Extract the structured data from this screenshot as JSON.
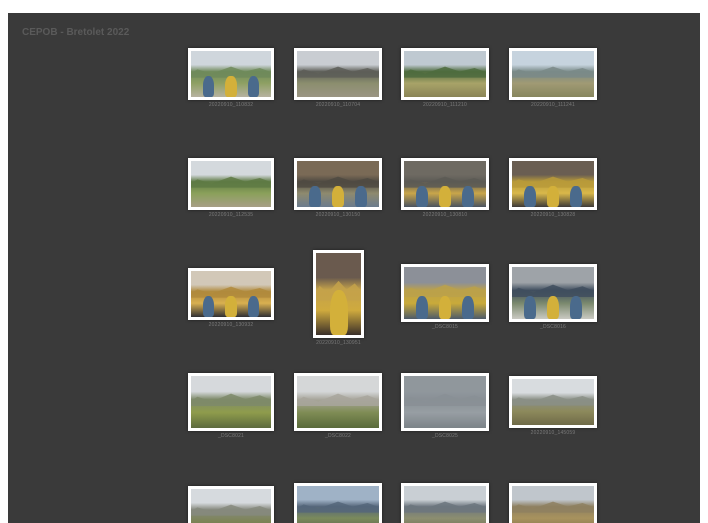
{
  "gallery": {
    "title": "CEPOB - Bretolet 2022",
    "colors": {
      "background": "#3a3a3a",
      "frame": "#ffffff",
      "caption": "#7a7a7a",
      "title": "#5a5a5a"
    },
    "thumbnails": [
      {
        "caption": "20220910_110832",
        "scene": "trail-hikers"
      },
      {
        "caption": "20220910_110704",
        "scene": "rocky-ridge"
      },
      {
        "caption": "20220910_111210",
        "scene": "grassy-valley"
      },
      {
        "caption": "20220910_111241",
        "scene": "mountain-meadow"
      },
      {
        "caption": "20220910_112535",
        "scene": "hill-path"
      },
      {
        "caption": "20220910_130150",
        "scene": "group-chalet"
      },
      {
        "caption": "20220910_130810",
        "scene": "group-closeup"
      },
      {
        "caption": "20220910_130828",
        "scene": "yellow-jacket"
      },
      {
        "caption": "20220910_130932",
        "scene": "hands-bird"
      },
      {
        "caption": "20220910_130951",
        "scene": "portrait-yellow"
      },
      {
        "caption": "_DSC8015",
        "scene": "man-yellow-outdoor"
      },
      {
        "caption": "_DSC8016",
        "scene": "group-table"
      },
      {
        "caption": "_DSC8021",
        "scene": "green-slope"
      },
      {
        "caption": "_DSC8022",
        "scene": "cliff-slope"
      },
      {
        "caption": "_DSC8025",
        "scene": "foggy-birds"
      },
      {
        "caption": "20220910_145059",
        "scene": "ridge-clouds"
      },
      {
        "caption": "",
        "scene": "mountain-range"
      },
      {
        "caption": "",
        "scene": "blue-mountains"
      },
      {
        "caption": "",
        "scene": "cloud-peak"
      },
      {
        "caption": "",
        "scene": "dry-hill"
      }
    ]
  }
}
